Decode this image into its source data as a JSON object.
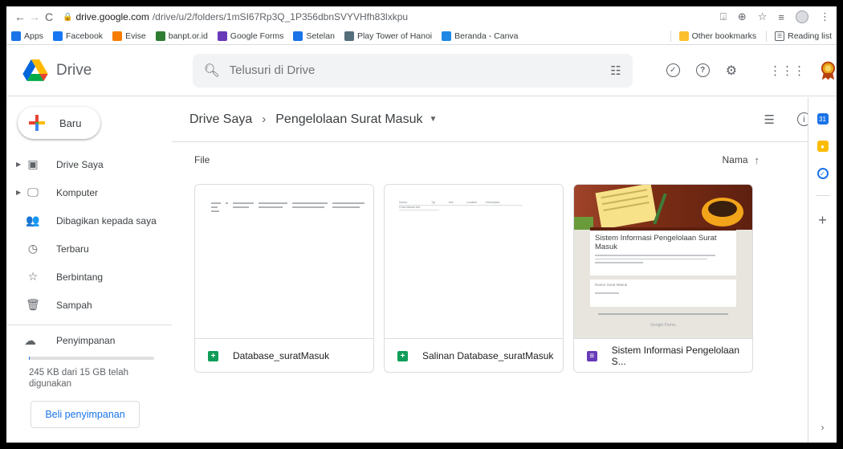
{
  "browser": {
    "url_host": "drive.google.com",
    "url_path": "/drive/u/2/folders/1mSI67Rp3Q_1P356dbnSVYVHfh83lxkpu",
    "bookmarks": [
      {
        "label": "Apps",
        "icon": "apps-grid-icon",
        "color": "#1a73e8"
      },
      {
        "label": "Facebook",
        "icon": "facebook-icon",
        "color": "#1877f2"
      },
      {
        "label": "Evise",
        "icon": "evise-icon",
        "color": "#f57c00"
      },
      {
        "label": "banpt.or.id",
        "icon": "banpt-icon",
        "color": "#2e7d32"
      },
      {
        "label": "Google Forms",
        "icon": "forms-icon",
        "color": "#673ab7"
      },
      {
        "label": "Setelan",
        "icon": "gear-icon",
        "color": "#1a73e8"
      },
      {
        "label": "Play Tower of Hanoi",
        "icon": "hanoi-icon",
        "color": "#546e7a"
      },
      {
        "label": "Beranda - Canva",
        "icon": "canva-icon",
        "color": "#1e88e5"
      }
    ],
    "other_bookmarks": "Other bookmarks",
    "reading_list": "Reading list"
  },
  "drive": {
    "app_name": "Drive",
    "search_placeholder": "Telusuri di Drive",
    "new_button": "Baru",
    "nav": [
      {
        "label": "Drive Saya",
        "icon": "my-drive-icon",
        "glyph": "▣",
        "caret": true
      },
      {
        "label": "Komputer",
        "icon": "computer-icon",
        "glyph": "🖵",
        "caret": true
      },
      {
        "label": "Dibagikan kepada saya",
        "icon": "shared-icon",
        "glyph": "👥",
        "caret": false
      },
      {
        "label": "Terbaru",
        "icon": "clock-icon",
        "glyph": "◷",
        "caret": false
      },
      {
        "label": "Berbintang",
        "icon": "star-icon",
        "glyph": "☆",
        "caret": false
      },
      {
        "label": "Sampah",
        "icon": "trash-icon",
        "glyph": "🗑",
        "caret": false
      }
    ],
    "storage_label": "Penyimpanan",
    "storage_usage": "245 KB dari 15 GB telah digunakan",
    "storage_fraction": 1.63e-05,
    "buy_storage": "Beli penyimpanan",
    "breadcrumb_root": "Drive Saya",
    "breadcrumb_current": "Pengelolaan Surat Masuk",
    "section_label": "File",
    "sort_label": "Nama",
    "files": [
      {
        "name": "Database_suratMasuk",
        "type": "sheets",
        "color": "#0f9d58"
      },
      {
        "name": "Salinan Database_suratMasuk",
        "type": "sheets",
        "color": "#0f9d58"
      },
      {
        "name": "Sistem Informasi Pengelolaan S...",
        "type": "forms",
        "color": "#673ab7"
      }
    ],
    "form_preview": {
      "title": "Sistem Informasi Pengelolaan Surat Masuk",
      "field": "Nomor Surat Masuk",
      "footer": "Google Forms"
    },
    "sheet_preview_headers": [
      "Nomor",
      "Tgl",
      "text",
      "Location",
      "Description"
    ],
    "sheet_preview_row": "Coba Masuk text"
  }
}
